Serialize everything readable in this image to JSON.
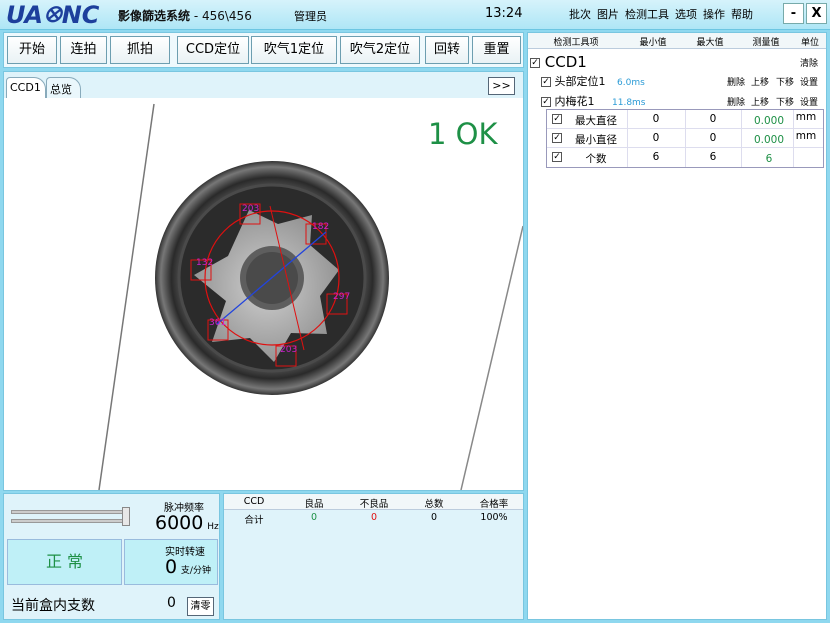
{
  "title_bar": {
    "logo": "UAꕕNC",
    "app_name": "影像篩选系统",
    "app_sub": " - 456\\456",
    "user_role": "管理员",
    "clock": "13:24",
    "menu": [
      "批次",
      "图片",
      "检测工具",
      "选项",
      "操作",
      "帮助"
    ],
    "minimize": "-",
    "close": "X"
  },
  "toolbar": {
    "start": "开始",
    "continuous": "连拍",
    "capture": "抓拍",
    "ccd_locate": "CCD定位",
    "blow1_locate": "吹气1定位",
    "blow2_locate": "吹气2定位",
    "rotate": "回转",
    "reset": "重置"
  },
  "camera": {
    "tabs": [
      "CCD1",
      "总览"
    ],
    "expand": ">>",
    "result": "1 OK",
    "labels": [
      "203",
      "182",
      "132",
      "297",
      "361",
      "203"
    ],
    "colors": {
      "outline": "#e01010",
      "label": "#cc22cc",
      "diameter": "#2244dd"
    }
  },
  "tool_panel": {
    "headers": [
      "检测工具项",
      "最小值",
      "最大值",
      "测量值",
      "单位"
    ],
    "ccd_name": "CCD1",
    "clear": "清除",
    "tools": [
      {
        "name": "头部定位1",
        "time": "6.0ms",
        "actions": [
          "删除",
          "上移",
          "下移",
          "设置"
        ]
      },
      {
        "name": "内梅花1",
        "time": "11.8ms",
        "actions": [
          "删除",
          "上移",
          "下移",
          "设置"
        ]
      }
    ],
    "rows": [
      {
        "name": "最大直径",
        "min": "0",
        "max": "0",
        "value": "0.000",
        "unit": "mm"
      },
      {
        "name": "最小直径",
        "min": "0",
        "max": "0",
        "value": "0.000",
        "unit": "mm"
      },
      {
        "name": "个数",
        "min": "6",
        "max": "6",
        "value": "6",
        "unit": ""
      }
    ],
    "check": "✓"
  },
  "controls": {
    "pulse_label": "脉冲频率",
    "pulse_value": "6000",
    "pulse_unit": "Hz",
    "status": "正 常",
    "speed_label": "实时转速",
    "speed_value": "0",
    "speed_unit": "支/分钟",
    "box_label": "当前盒内支数",
    "box_value": "0",
    "clear_btn": "清零",
    "slider_level": 1.0
  },
  "stats": {
    "headers": [
      "CCD",
      "良品",
      "不良品",
      "总数",
      "合格率"
    ],
    "row": [
      "合计",
      "0",
      "0",
      "0",
      "100%"
    ],
    "colors": {
      "good": "#1e9046",
      "bad": "#e01010"
    }
  }
}
